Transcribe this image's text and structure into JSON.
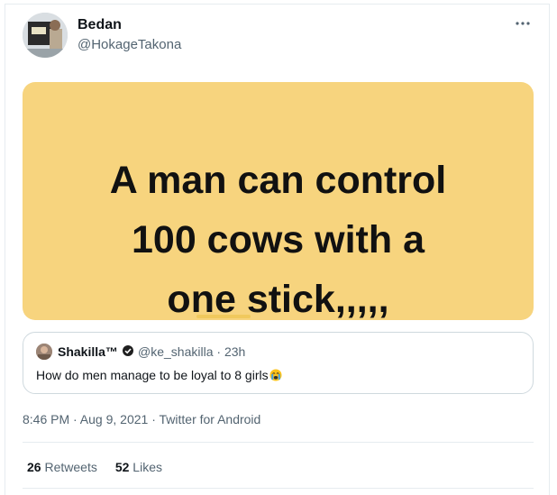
{
  "tweet": {
    "author_name": "Bedan",
    "author_handle": "@HokageTakona",
    "more_icon": "more-dots-icon",
    "media_text": "A man can control\n100 cows with a\none stick,,,,,",
    "timestamp": "8:46 PM · Aug 9, 2021 · Twitter for Android",
    "retweets_count": "26",
    "retweets_label": "Retweets",
    "likes_count": "52",
    "likes_label": "Likes"
  },
  "quoted_tweet": {
    "author_name": "Shakilla™",
    "verified_icon": "verified-badge-icon",
    "author_handle": "@ke_shakilla",
    "separator": "·",
    "time": "23h",
    "text": "How do men manage to be loyal to 8 girls",
    "emoji": "crying-face-emoji"
  },
  "colors": {
    "media_background": "#f7d47e",
    "secondary_text": "#536471",
    "border": "#cfd9de"
  }
}
